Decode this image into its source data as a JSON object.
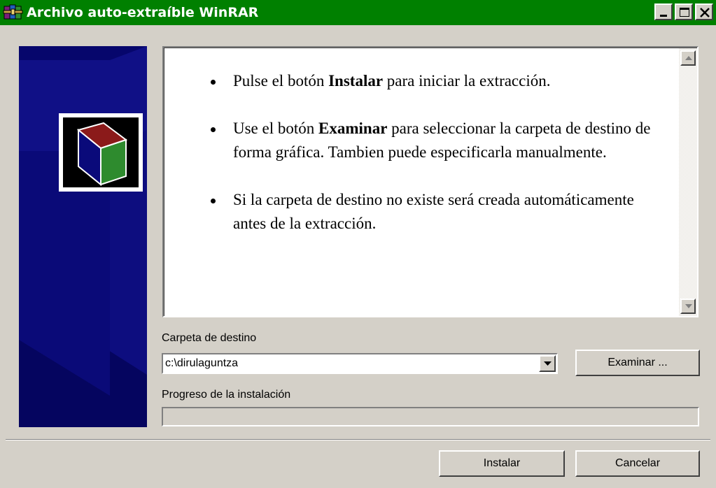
{
  "window": {
    "title": "Archivo auto-extraíble WinRAR",
    "title_bar_color": "#008000",
    "icon": "winrar-books-icon",
    "controls": [
      "minimize-icon",
      "maximize-icon",
      "close-icon"
    ]
  },
  "banner": {
    "background_color": "#0a0a7a",
    "logo": "winrar-box-logo"
  },
  "instructions": [
    {
      "before": "Pulse el botón ",
      "bold": "Instalar",
      "after": " para iniciar la extracción."
    },
    {
      "before": "Use el botón ",
      "bold": "Examinar",
      "after": " para seleccionar la carpeta de destino de forma gráfica. Tambien puede especificarla manualmente."
    },
    {
      "before": "Si la carpeta de destino no existe será creada automáticamente antes de la extracción.",
      "bold": "",
      "after": ""
    }
  ],
  "destination": {
    "label": "Carpeta de destino",
    "value": "c:\\dirulaguntza",
    "browse_label": "Examinar ..."
  },
  "progress": {
    "label": "Progreso de la instalación",
    "value": 0
  },
  "footer": {
    "install_label": "Instalar",
    "cancel_label": "Cancelar"
  }
}
